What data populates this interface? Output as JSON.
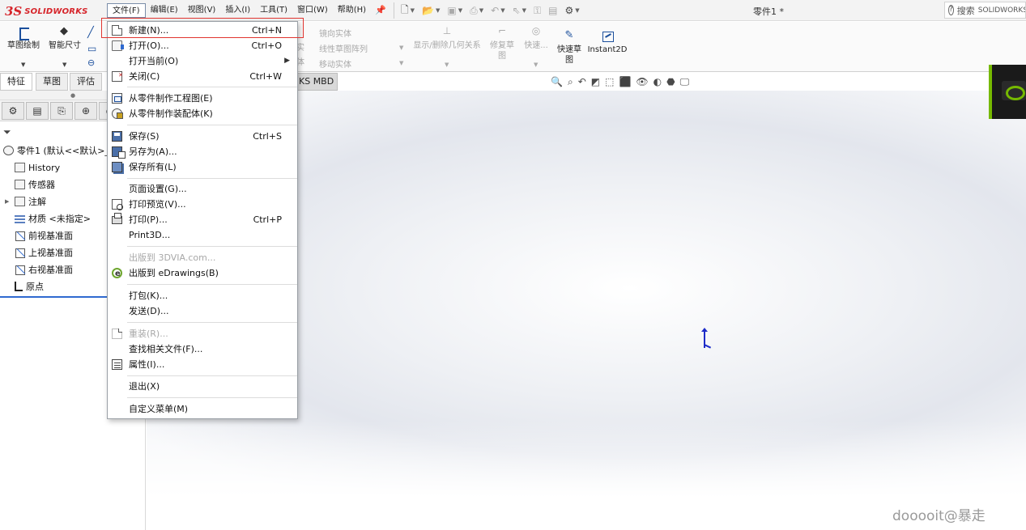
{
  "app": {
    "logo_ds": "3S",
    "logo_text": "SOLIDWORKS",
    "doc_title": "零件1 *"
  },
  "menubar": [
    "文件(F)",
    "编辑(E)",
    "视图(V)",
    "插入(I)",
    "工具(T)",
    "窗口(W)",
    "帮助(H)"
  ],
  "search": {
    "label": "搜索",
    "scope": "SOLIDWORKS"
  },
  "command_manager": {
    "sketch": "草图绘制",
    "smart_dim": "智能尺寸",
    "mirror_entities": "镜向实体",
    "linear_pattern": "线性草图阵列",
    "move_entities": "移动实体",
    "show_relations": "显示/删除几何关系",
    "repair_sketch": [
      "修复草",
      "图"
    ],
    "quick": "快速...",
    "rapid_sketch": [
      "快速草",
      "图"
    ],
    "instant2d": "Instant2D",
    "partial": [
      "实",
      "体"
    ]
  },
  "tabs": {
    "features": "特征",
    "sketch": "草图",
    "evaluate": "评估",
    "mbd": "KS MBD"
  },
  "tree": [
    {
      "label": "零件1 (默认<<默认>_",
      "icon": "part-icon"
    },
    {
      "label": "History",
      "icon": "history-icon"
    },
    {
      "label": "传感器",
      "icon": "sensor-icon"
    },
    {
      "label": "注解",
      "icon": "annotation-icon"
    },
    {
      "label": "材质 <未指定>",
      "icon": "material-icon"
    },
    {
      "label": "前视基准面",
      "icon": "plane-icon"
    },
    {
      "label": "上视基准面",
      "icon": "plane-icon"
    },
    {
      "label": "右视基准面",
      "icon": "plane-icon"
    },
    {
      "label": "原点",
      "icon": "origin-icon"
    }
  ],
  "file_menu": [
    {
      "label": "新建(N)...",
      "shortcut": "Ctrl+N",
      "icon": "new-document-icon"
    },
    {
      "label": "打开(O)...",
      "shortcut": "Ctrl+O",
      "icon": "open-folder-icon"
    },
    {
      "label": "打开当前(O)",
      "shortcut": "",
      "submenu": true
    },
    {
      "label": "关闭(C)",
      "shortcut": "Ctrl+W",
      "icon": "close-document-icon"
    },
    {
      "label": "从零件制作工程图(E)",
      "shortcut": "",
      "icon": "drawing-icon"
    },
    {
      "label": "从零件制作装配体(K)",
      "shortcut": "",
      "icon": "assembly-icon"
    },
    {
      "label": "保存(S)",
      "shortcut": "Ctrl+S",
      "icon": "save-icon"
    },
    {
      "label": "另存为(A)...",
      "shortcut": "",
      "icon": "save-as-icon"
    },
    {
      "label": "保存所有(L)",
      "shortcut": "",
      "icon": "save-all-icon"
    },
    {
      "label": "页面设置(G)...",
      "shortcut": ""
    },
    {
      "label": "打印预览(V)...",
      "shortcut": "",
      "icon": "print-preview-icon"
    },
    {
      "label": "打印(P)...",
      "shortcut": "Ctrl+P",
      "icon": "print-icon"
    },
    {
      "label": "Print3D...",
      "shortcut": ""
    },
    {
      "label": "出版到 3DVIA.com...",
      "shortcut": "",
      "disabled": true
    },
    {
      "label": "出版到 eDrawings(B)",
      "shortcut": "",
      "icon": "edrawings-icon"
    },
    {
      "label": "打包(K)...",
      "shortcut": ""
    },
    {
      "label": "发送(D)...",
      "shortcut": ""
    },
    {
      "label": "重装(R)...",
      "shortcut": "",
      "disabled": true
    },
    {
      "label": "查找相关文件(F)...",
      "shortcut": ""
    },
    {
      "label": "属性(I)...",
      "shortcut": "",
      "icon": "properties-icon"
    },
    {
      "label": "退出(X)",
      "shortcut": ""
    },
    {
      "label": "自定义菜单(M)",
      "shortcut": ""
    }
  ],
  "watermark": "dooooit@暴走",
  "colors": {
    "accent": "#2f6ad0",
    "highlight_box": "#e0342f",
    "nvidia_green": "#76b900"
  }
}
